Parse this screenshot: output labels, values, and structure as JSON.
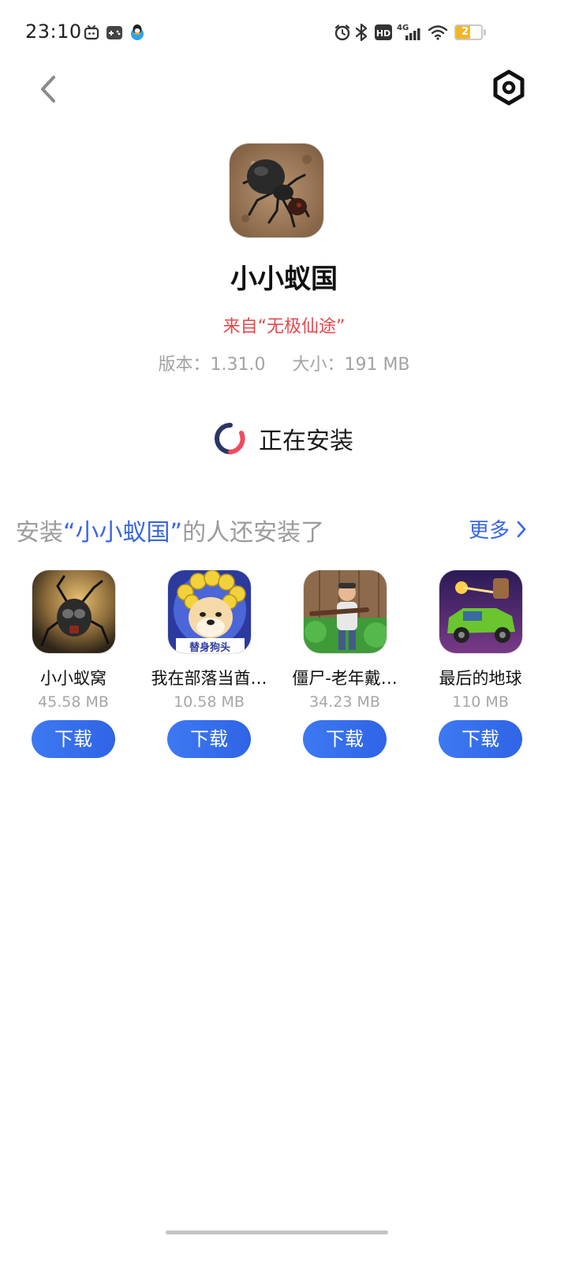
{
  "status_bar": {
    "time": "23:10",
    "notification_icons": [
      "tv-app-icon",
      "game-controller-icon",
      "qq-penguin-icon"
    ],
    "system_icons": [
      "alarm-icon",
      "bluetooth-icon",
      "hd-icon",
      "4g-signal-icon",
      "wifi-icon"
    ],
    "network_label": "4G",
    "hd_label": "HD",
    "battery_level": 21,
    "battery_label": "21",
    "battery_color": "#f1b722"
  },
  "nav": {
    "back_icon": "chevron-left-icon",
    "settings_icon": "hexagon-settings-icon"
  },
  "app": {
    "name": "小小蚁国",
    "source": "来自“无极仙途”",
    "version_label": "版本：1.31.0",
    "size_label": "大小：191 MB",
    "icon": "ant-app-icon"
  },
  "install": {
    "status_label": "正在安装",
    "spinner_colors": [
      "#2c3566",
      "#ef4b5b"
    ]
  },
  "recommend": {
    "title_prefix": "安装",
    "title_highlight": "“小小蚁国”",
    "title_suffix": "的人还安装了",
    "more_label": "更多",
    "highlight_color": "#3a67e0",
    "apps": [
      {
        "name": "小小蚁窝",
        "size": "45.58 MB",
        "button": "下载",
        "icon": "ant-warrior-icon"
      },
      {
        "name": "我在部落当酋…",
        "size": "10.58 MB",
        "button": "下载",
        "icon": "doge-character-icon",
        "icon_text": "替身狗头"
      },
      {
        "name": "僵尸-老年戴…",
        "size": "34.23 MB",
        "button": "下载",
        "icon": "old-man-gun-icon"
      },
      {
        "name": "最后的地球",
        "size": "110 MB",
        "button": "下载",
        "icon": "green-truck-icon"
      }
    ]
  }
}
